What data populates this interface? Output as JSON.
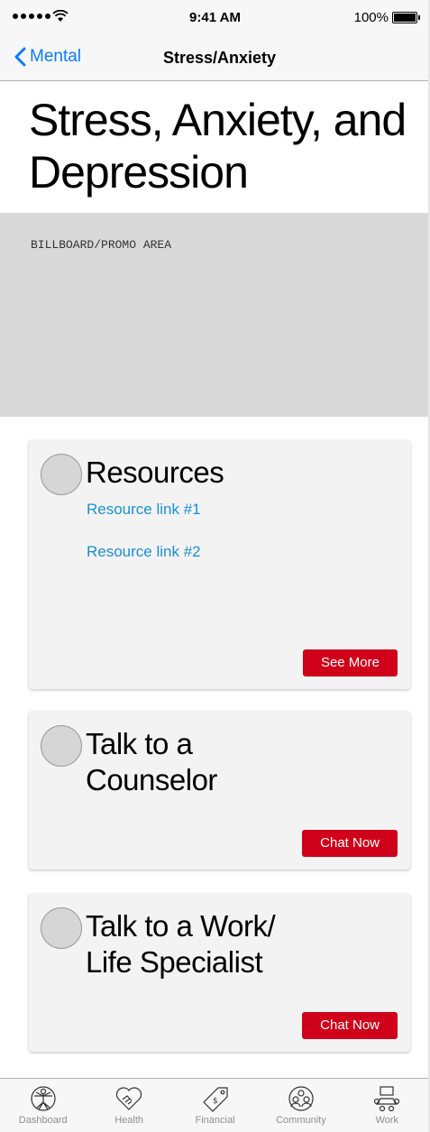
{
  "status_bar": {
    "time": "9:41 AM",
    "battery": "100%"
  },
  "nav": {
    "back_label": "Mental",
    "title": "Stress/Anxiety"
  },
  "page": {
    "title": "Stress, Anxiety, and Depression"
  },
  "billboard": {
    "label": "BILLBOARD/PROMO AREA"
  },
  "cards": [
    {
      "title": "Resources",
      "links": [
        "Resource link #1",
        "Resource link #2"
      ],
      "button": "See More"
    },
    {
      "title_line1": "Talk to a",
      "title_line2": "Counselor",
      "button": "Chat Now"
    },
    {
      "title_line1": "Talk to a Work/",
      "title_line2": "Life Specialist",
      "button": "Chat Now"
    }
  ],
  "tabs": [
    {
      "label": "Dashboard",
      "icon": "vitruvian-icon"
    },
    {
      "label": "Health",
      "icon": "heart-handshake-icon"
    },
    {
      "label": "Financial",
      "icon": "price-tag-icon"
    },
    {
      "label": "Community",
      "icon": "people-group-icon"
    },
    {
      "label": "Work",
      "icon": "meeting-table-icon"
    }
  ],
  "colors": {
    "link": "#1a8fd6",
    "back": "#0a7aff",
    "button": "#d0021b",
    "billboard": "#d9d9d9"
  }
}
